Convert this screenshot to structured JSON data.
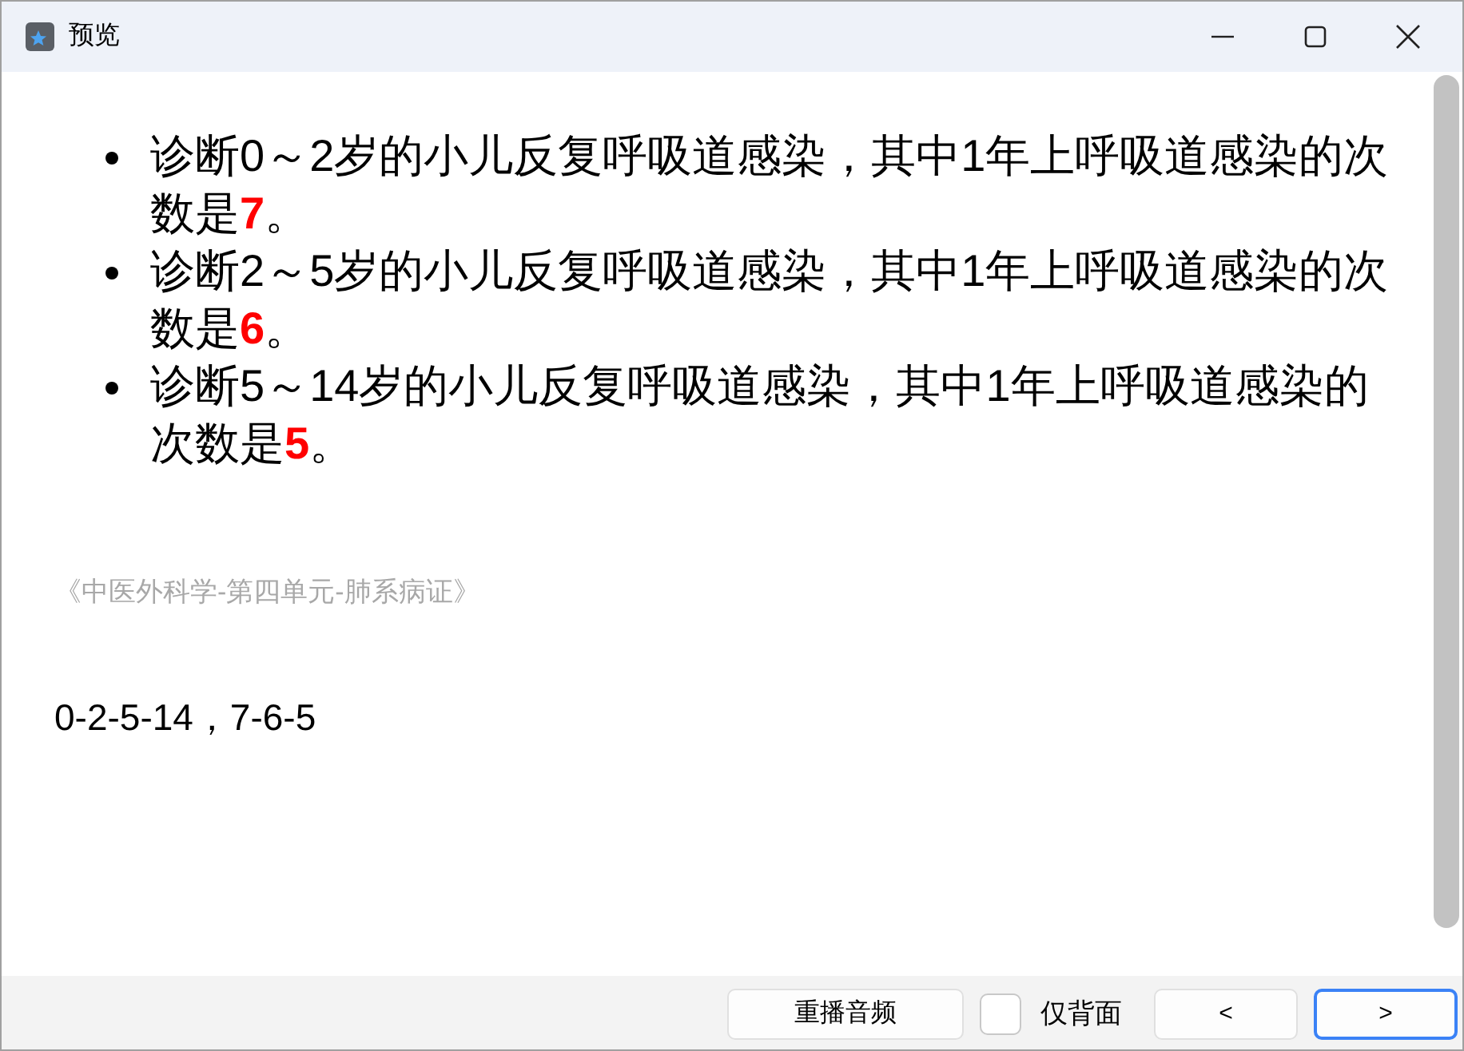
{
  "window": {
    "title": "预览"
  },
  "items": [
    {
      "text": "诊断0～2岁的小儿反复呼吸道感染，其中1年上呼吸道感染的次数是",
      "highlight": "7",
      "end": "。"
    },
    {
      "text": "诊断2～5岁的小儿反复呼吸道感染，其中1年上呼吸道感染的次数是",
      "highlight": "6",
      "end": "。"
    },
    {
      "text": "诊断5～14岁的小儿反复呼吸道感染，其中1年上呼吸道感染的次数是",
      "highlight": "5",
      "end": "。"
    }
  ],
  "source": "《中医外科学-第四单元-肺系病证》",
  "answer": "0-2-5-14，7-6-5",
  "footer": {
    "replay_button": "重播音频",
    "back_only": {
      "label": "仅背面",
      "checked": false
    },
    "prev_button": "<",
    "next_button": ">"
  }
}
